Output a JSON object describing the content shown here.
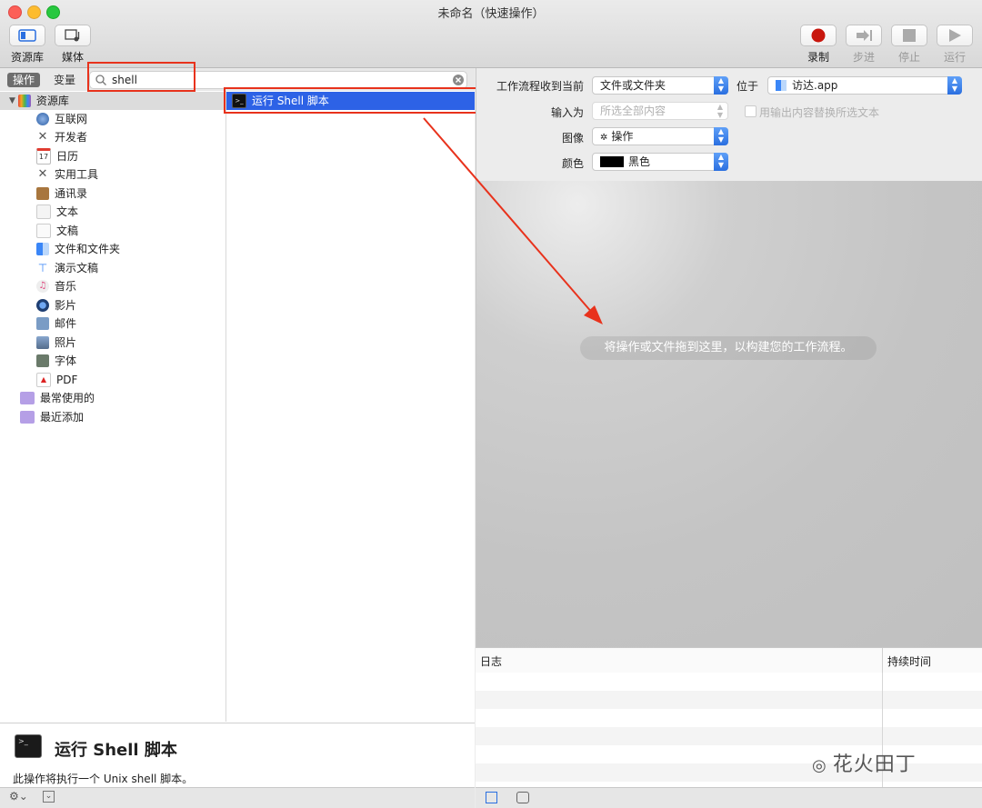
{
  "window": {
    "title": "未命名（快速操作）"
  },
  "toolbar": {
    "library_label": "资源库",
    "media_label": "媒体",
    "record_label": "录制",
    "step_label": "步进",
    "stop_label": "停止",
    "run_label": "运行"
  },
  "scope": {
    "actions_tab": "操作",
    "variables_tab": "变量"
  },
  "search": {
    "value": "shell"
  },
  "library": {
    "root": "资源库",
    "items": [
      "互联网",
      "开发者",
      "日历",
      "实用工具",
      "通讯录",
      "文本",
      "文稿",
      "文件和文件夹",
      "演示文稿",
      "音乐",
      "影片",
      "邮件",
      "照片",
      "字体",
      "PDF"
    ],
    "calendar_day": "17",
    "most_used": "最常使用的",
    "recently_added": "最近添加"
  },
  "actions": {
    "results": [
      "运行 Shell 脚本"
    ]
  },
  "info": {
    "title": "运行 Shell 脚本",
    "description": "此操作将执行一个 Unix shell 脚本。",
    "terminal_glyph": ">_"
  },
  "workflow": {
    "receives_label": "工作流程收到当前",
    "receives_value": "文件或文件夹",
    "in_label": "位于",
    "in_value": "访达.app",
    "input_label": "输入为",
    "input_value": "所选全部内容",
    "replace_label": "用输出内容替换所选文本",
    "image_label": "图像",
    "image_value": "操作",
    "color_label": "颜色",
    "color_value": "黑色"
  },
  "canvas": {
    "hint": "将操作或文件拖到这里，以构建您的工作流程。"
  },
  "log": {
    "col_log": "日志",
    "col_duration": "持续时间"
  },
  "watermark": {
    "text": "花火田丁"
  },
  "colors": {
    "accent": "#2a6fe0",
    "selection": "#2d62e6",
    "annotation": "#e8321c",
    "record": "#c8160d"
  }
}
